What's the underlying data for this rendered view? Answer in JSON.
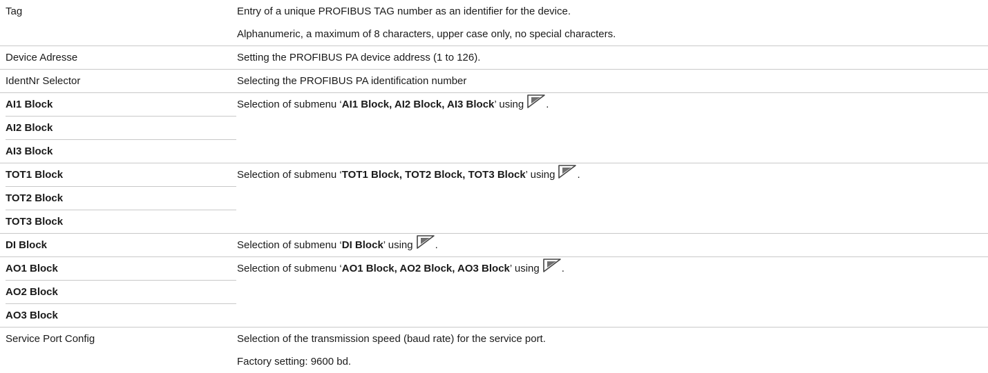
{
  "rows": [
    {
      "params": [
        "Tag"
      ],
      "bold": false,
      "desc": [
        "Entry of a unique PROFIBUS TAG number as an identifier for the device.",
        "Alphanumeric, a maximum of 8 characters, upper case only, no special characters."
      ]
    },
    {
      "params": [
        "Device Adresse"
      ],
      "bold": false,
      "desc": [
        "Setting the PROFIBUS PA device address (1 to 126)."
      ]
    },
    {
      "params": [
        "IdentNr Selector"
      ],
      "bold": false,
      "desc": [
        "Selecting the PROFIBUS PA identification number"
      ]
    },
    {
      "params": [
        "AI1 Block",
        "AI2 Block",
        "AI3 Block"
      ],
      "bold": true,
      "submenu": {
        "prefix": "Selection of submenu ‘",
        "name": "AI1 Block, AI2 Block, AI3 Block",
        "suffix": "’ using",
        "end": "."
      }
    },
    {
      "params": [
        "TOT1 Block",
        "TOT2 Block",
        "TOT3 Block"
      ],
      "bold": true,
      "submenu": {
        "prefix": "Selection of submenu ‘",
        "name": "TOT1 Block, TOT2 Block, TOT3 Block",
        "suffix": "’ using",
        "end": "."
      }
    },
    {
      "params": [
        "DI Block"
      ],
      "bold": true,
      "submenu": {
        "prefix": "Selection of submenu ‘",
        "name": "DI Block",
        "suffix": "’ using",
        "end": "."
      }
    },
    {
      "params": [
        "AO1 Block",
        "AO2 Block",
        "AO3 Block"
      ],
      "bold": true,
      "submenu": {
        "prefix": "Selection of submenu ‘",
        "name": "AO1 Block, AO2 Block, AO3 Block",
        "suffix": "’ using",
        "end": "."
      }
    },
    {
      "params": [
        "Service Port Config"
      ],
      "bold": false,
      "desc": [
        "Selection of the transmission speed (baud rate) for the service port.",
        "Factory setting: 9600 bd."
      ]
    }
  ],
  "icon": "enter-key-icon"
}
